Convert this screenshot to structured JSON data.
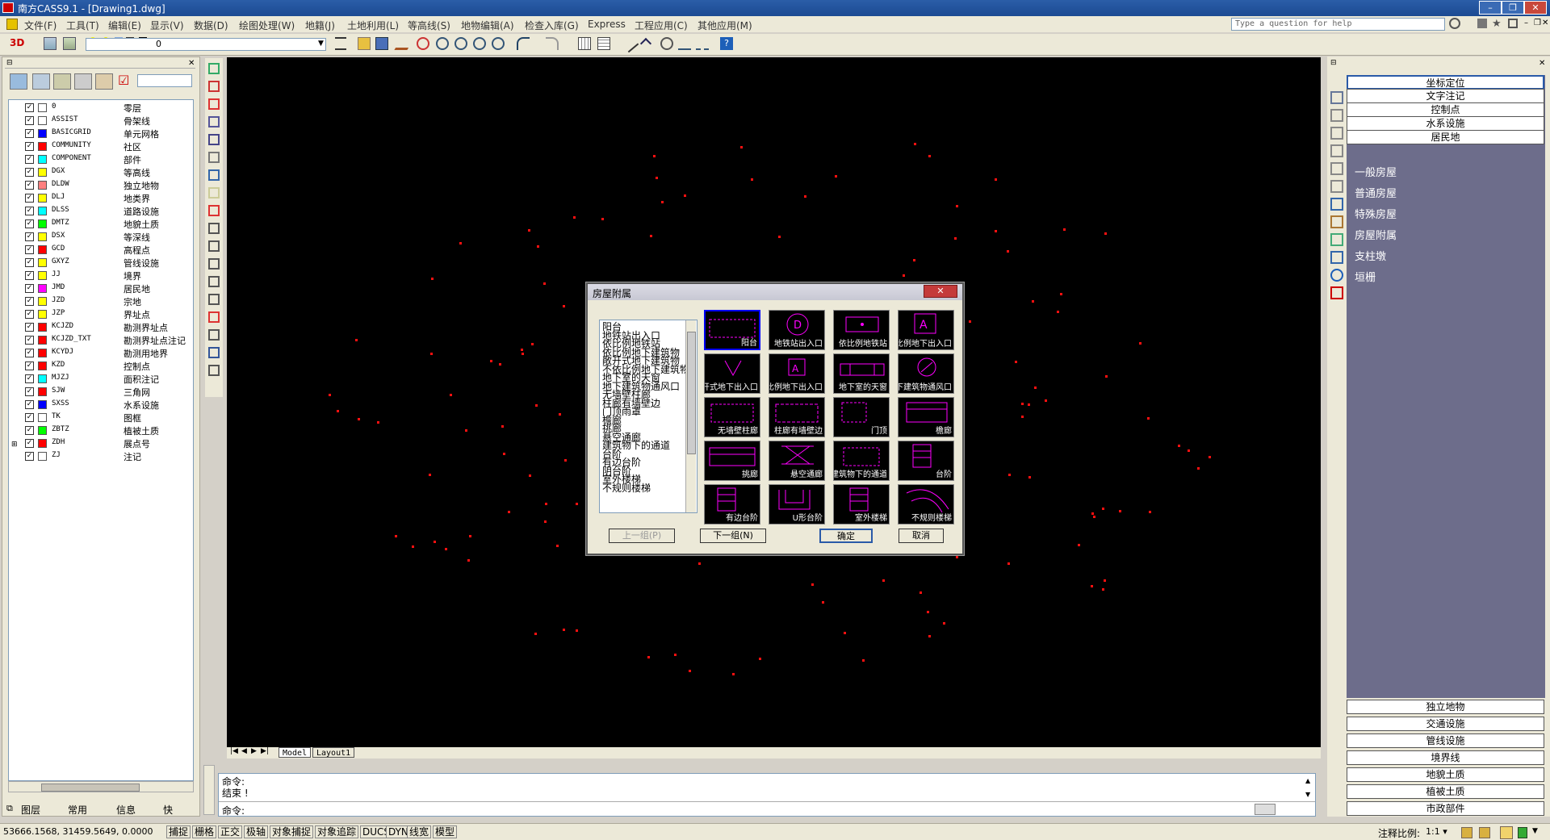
{
  "window": {
    "title": "南方CASS9.1 - [Drawing1.dwg]",
    "buttons": [
      "–",
      "❐",
      "✕"
    ]
  },
  "menu": [
    "文件(F)",
    "工具(T)",
    "编辑(E)",
    "显示(V)",
    "数据(D)",
    "绘图处理(W)",
    "地籍(J)",
    "土地利用(L)",
    "等高线(S)",
    "地物编辑(A)",
    "检查入库(G)",
    "Express",
    "工程应用(C)",
    "其他应用(M)"
  ],
  "help_placeholder": "Type a question for help",
  "toolbar": {
    "btn3d": "3D",
    "layer_value": "0"
  },
  "layers": [
    {
      "name": "0",
      "desc": "零层",
      "color": "#ffffff"
    },
    {
      "name": "ASSIST",
      "desc": "骨架线",
      "color": "#ffffff"
    },
    {
      "name": "BASICGRID",
      "desc": "单元网格",
      "color": "#0000ff"
    },
    {
      "name": "COMMUNITY",
      "desc": "社区",
      "color": "#ff0000"
    },
    {
      "name": "COMPONENT",
      "desc": "部件",
      "color": "#00ffff"
    },
    {
      "name": "DGX",
      "desc": "等高线",
      "color": "#ffff00"
    },
    {
      "name": "DLDW",
      "desc": "独立地物",
      "color": "#ff8080"
    },
    {
      "name": "DLJ",
      "desc": "地类界",
      "color": "#ffff00"
    },
    {
      "name": "DLSS",
      "desc": "道路设施",
      "color": "#00ffff"
    },
    {
      "name": "DMTZ",
      "desc": "地貌土质",
      "color": "#00ff00"
    },
    {
      "name": "DSX",
      "desc": "等深线",
      "color": "#ffff00"
    },
    {
      "name": "GCD",
      "desc": "高程点",
      "color": "#ff0000"
    },
    {
      "name": "GXYZ",
      "desc": "管线设施",
      "color": "#ffff00"
    },
    {
      "name": "JJ",
      "desc": "境界",
      "color": "#ffff00"
    },
    {
      "name": "JMD",
      "desc": "居民地",
      "color": "#ff00ff"
    },
    {
      "name": "JZD",
      "desc": "宗地",
      "color": "#ffff00"
    },
    {
      "name": "JZP",
      "desc": "界址点",
      "color": "#ffff00"
    },
    {
      "name": "KCJZD",
      "desc": "勘测界址点",
      "color": "#ff0000"
    },
    {
      "name": "KCJZD_TXT",
      "desc": "勘测界址点注记",
      "color": "#ff0000"
    },
    {
      "name": "KCYDJ",
      "desc": "勘测用地界",
      "color": "#ff0000"
    },
    {
      "name": "KZD",
      "desc": "控制点",
      "color": "#ff0000"
    },
    {
      "name": "MJZJ",
      "desc": "面积注记",
      "color": "#00ffff"
    },
    {
      "name": "SJW",
      "desc": "三角网",
      "color": "#ff0000"
    },
    {
      "name": "SXSS",
      "desc": "水系设施",
      "color": "#0000ff"
    },
    {
      "name": "TK",
      "desc": "图框",
      "color": "#ffffff"
    },
    {
      "name": "ZBTZ",
      "desc": "植被土质",
      "color": "#00ff00"
    },
    {
      "name": "ZDH",
      "desc": "展点号",
      "color": "#ff0000"
    },
    {
      "name": "ZJ",
      "desc": "注记",
      "color": "#ffffff"
    }
  ],
  "left_tabs": [
    "图层",
    "常用",
    "信息",
    "快"
  ],
  "layout_tabs": [
    "Model",
    "Layout1"
  ],
  "command": {
    "line1": "命令:",
    "line2": "结束 !",
    "prompt": "命令:"
  },
  "status": {
    "coords": "53666.1568, 31459.5649, 0.0000",
    "buttons": [
      "捕捉",
      "栅格",
      "正交",
      "极轴",
      "对象捕捉",
      "对象追踪",
      "DUCS",
      "DYN",
      "线宽",
      "模型"
    ],
    "scale_label": "注释比例:",
    "scale_value": "1:1 ▾"
  },
  "right_panel": {
    "top_buttons": [
      "坐标定位",
      "文字注记",
      "控制点",
      "水系设施",
      "居民地"
    ],
    "items": [
      "一般房屋",
      "普通房屋",
      "特殊房屋",
      "房屋附属",
      "支柱墩",
      "垣栅"
    ],
    "bottom_buttons": [
      "独立地物",
      "交通设施",
      "管线设施",
      "境界线",
      "地貌土质",
      "植被土质",
      "市政部件"
    ]
  },
  "dialog": {
    "title": "房屋附属",
    "close": "✕",
    "list": [
      "阳台",
      "地铁站出入口",
      "依比例地铁站",
      "依比例地下建筑物",
      "敞开式地下建筑物",
      "不依比例地下建筑物",
      "地下室的天窗",
      "地下建筑物通风口",
      "无墙壁柱廊",
      "柱廊有墙壁边",
      "门顶雨罩",
      "檐廊",
      "挑廊",
      "悬空通廊",
      "建筑物下的通道",
      "台阶",
      "有边台阶",
      "阴台阶",
      "室外楼梯",
      "不规则楼梯"
    ],
    "cells": [
      "阳台",
      "地铁站出入口",
      "依比例地铁站",
      "依比例地下出入口",
      "敞开式地下出入口",
      "不依比例地下出入口",
      "地下室的天窗",
      "地下建筑物通风口",
      "无墙壁柱廊",
      "柱廊有墙壁边",
      "门顶",
      "檐廊",
      "挑廊",
      "悬空通廊",
      "建筑物下的通道",
      "台阶",
      "有边台阶",
      "U形台阶",
      "室外楼梯",
      "不规则楼梯"
    ],
    "buttons": {
      "prev": "上一组(P)",
      "next": "下一组(N)",
      "ok": "确定",
      "cancel": "取消"
    }
  }
}
